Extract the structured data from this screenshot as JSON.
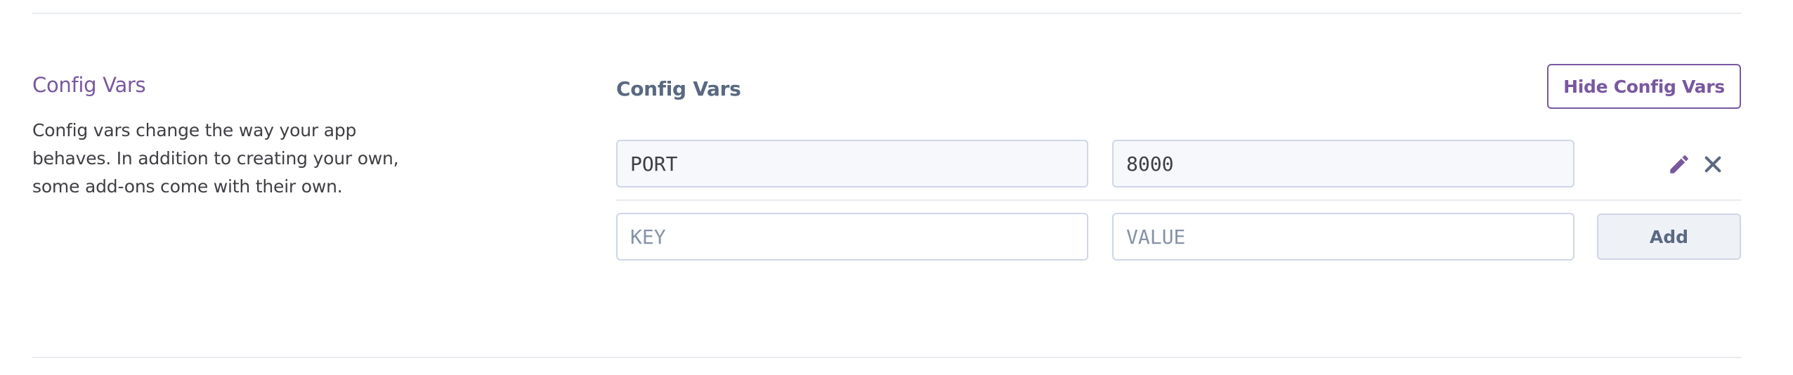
{
  "section": {
    "title": "Config Vars",
    "description": "Config vars change the way your app behaves. In addition to creating your own, some add-ons come with their own."
  },
  "panel": {
    "title": "Config Vars",
    "hide_button_label": "Hide Config Vars"
  },
  "config_vars": [
    {
      "key": "PORT",
      "value": "8000"
    }
  ],
  "new_var": {
    "key_placeholder": "KEY",
    "value_placeholder": "VALUE",
    "add_button_label": "Add"
  },
  "icons": {
    "edit": "pencil-icon",
    "delete": "close-icon"
  },
  "colors": {
    "accent": "#79589f",
    "heading": "#596981",
    "text": "#3f3f44",
    "border": "#cfd7e6",
    "icon": "#596981"
  }
}
